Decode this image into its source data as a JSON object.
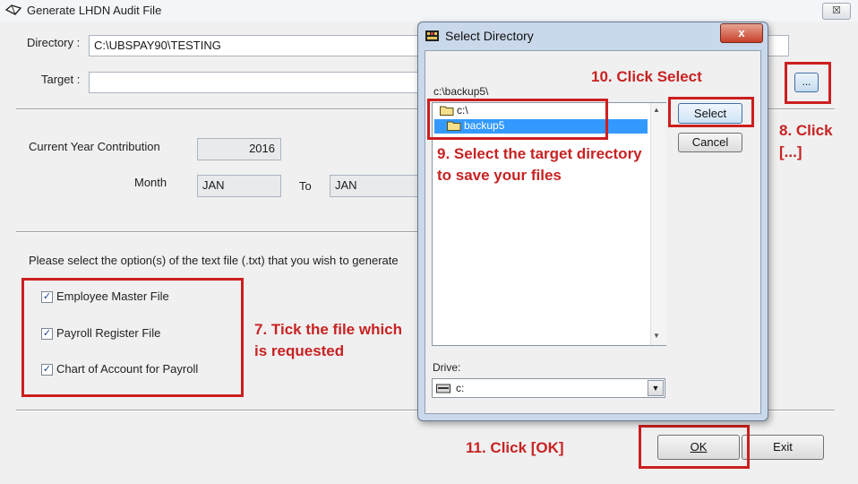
{
  "main_window": {
    "title": "Generate LHDN Audit File",
    "close_label": "☒"
  },
  "form": {
    "directory_label": "Directory :",
    "directory_value": "C:\\UBSPAY90\\TESTING",
    "target_label": "Target :",
    "target_value": "",
    "browse_label": "...",
    "year_label": "Current Year Contribution",
    "year_value": "2016",
    "month_label": "Month",
    "month_from": "JAN",
    "to_label": "To",
    "month_to": "JAN",
    "options_prompt": "Please select the option(s) of the text file (.txt) that you wish to generate",
    "options": [
      {
        "label": "Employee Master File",
        "checked": true
      },
      {
        "label": "Payroll Register File",
        "checked": true
      },
      {
        "label": "Chart of Account for Payroll",
        "checked": true
      }
    ],
    "ok_label": "OK",
    "exit_label": "Exit"
  },
  "dialog": {
    "title": "Select Directory",
    "close_label": "x",
    "current_path": "c:\\backup5\\",
    "tree": [
      {
        "label": "c:\\",
        "selected": false
      },
      {
        "label": "backup5",
        "selected": true
      }
    ],
    "select_label": "Select",
    "cancel_label": "Cancel",
    "drive_label": "Drive:",
    "drive_value": "c:"
  },
  "annotations": {
    "step7": "7. Tick the file which is requested",
    "step8": "8. Click [...]",
    "step9": "9. Select the target directory to save your files",
    "step10": "10. Click Select",
    "step11": "11. Click [OK]"
  },
  "colors": {
    "annotation_red": "#cc1f1f",
    "selection_blue": "#3399ff",
    "dialog_frame": "#c9d8ea"
  }
}
